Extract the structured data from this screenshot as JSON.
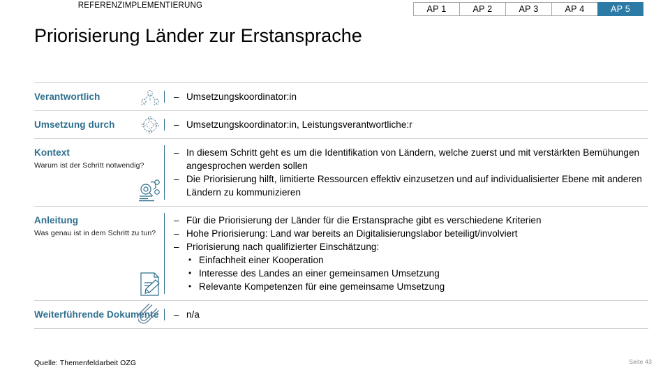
{
  "header": {
    "eyebrow": "REFERENZIMPLEMENTIERUNG",
    "title": "Priorisierung Länder zur Erstansprache"
  },
  "tabs": [
    {
      "label": "AP 1",
      "active": false
    },
    {
      "label": "AP 2",
      "active": false
    },
    {
      "label": "AP 3",
      "active": false
    },
    {
      "label": "AP 4",
      "active": false
    },
    {
      "label": "AP 5",
      "active": true
    }
  ],
  "colors": {
    "accent": "#2e6f8e",
    "tab_active_bg": "#2c7ba6",
    "divider": "#d2d2d2",
    "page_number": "#8a8a8a"
  },
  "rows": [
    {
      "label": "Verantwortlich",
      "sublabel": "",
      "icon": "people-network-icon",
      "bullets": [
        "Umsetzungskoordinator:in"
      ],
      "subbullets": []
    },
    {
      "label": "Umsetzung durch",
      "sublabel": "",
      "icon": "team-circle-icon",
      "bullets": [
        "Umsetzungskoordinator:in, Leistungsverantwortliche:r"
      ],
      "subbullets": []
    },
    {
      "label": "Kontext",
      "sublabel": "Warum ist der Schritt notwendig?",
      "icon": "magnifier-document-icon",
      "bullets": [
        "In diesem Schritt geht es um die Identifikation von Ländern, welche zuerst und mit verstärkten Bemühungen angesprochen werden sollen",
        "Die Priorisierung hilft, limitierte Ressourcen effektiv einzusetzen und auf individualisierter Ebene mit anderen Ländern zu kommunizieren"
      ],
      "subbullets": []
    },
    {
      "label": "Anleitung",
      "sublabel": "Was genau ist in dem Schritt zu tun?",
      "icon": "document-pencil-icon",
      "bullets": [
        "Für die Priorisierung der Länder für die Erstansprache gibt es verschiedene Kriterien",
        "Hohe Priorisierung: Land war bereits an Digitalisierungslabor beteiligt/involviert",
        "Priorisierung nach qualifizierter Einschätzung:"
      ],
      "subbullets": [
        "Einfachheit einer Kooperation",
        "Interesse des Landes an einer gemeinsamen Umsetzung",
        "Relevante Kompetenzen für eine gemeinsame Umsetzung"
      ]
    },
    {
      "label": "Weiterführende Dokumente",
      "sublabel": "",
      "icon": "paperclip-icon",
      "bullets": [
        "n/a"
      ],
      "subbullets": []
    }
  ],
  "footer": {
    "source": "Quelle: Themenfeldarbeit OZG",
    "page_number": "Seite 43"
  }
}
